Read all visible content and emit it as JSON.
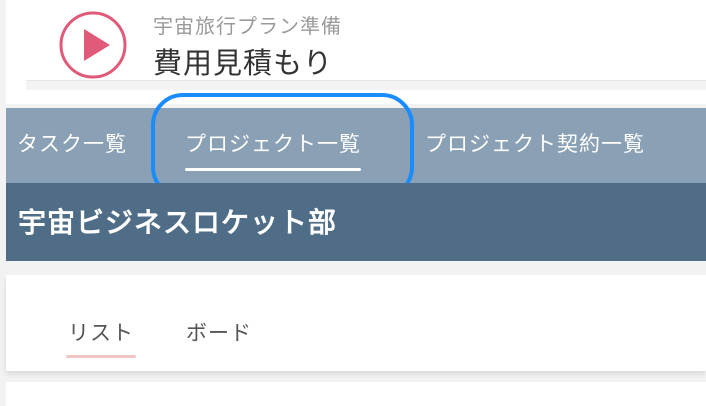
{
  "header": {
    "subtitle": "宇宙旅行プラン準備",
    "title": "費用見積もり",
    "play_icon_color": "#e05a7a"
  },
  "tabs": [
    {
      "label": "タスク一覧",
      "selected": false
    },
    {
      "label": "プロジェクト一覧",
      "selected": true
    },
    {
      "label": "プロジェクト契約一覧",
      "selected": false
    }
  ],
  "department": {
    "name": "宇宙ビジネスロケット部"
  },
  "view_tabs": [
    {
      "label": "リスト",
      "selected": true
    },
    {
      "label": "ボード",
      "selected": false
    }
  ],
  "colors": {
    "tabbar_bg": "#8aa0b4",
    "dept_bg": "#4f6d87",
    "focus_ring": "#1a8cff",
    "selected_view_underline": "#f4c5c5"
  }
}
